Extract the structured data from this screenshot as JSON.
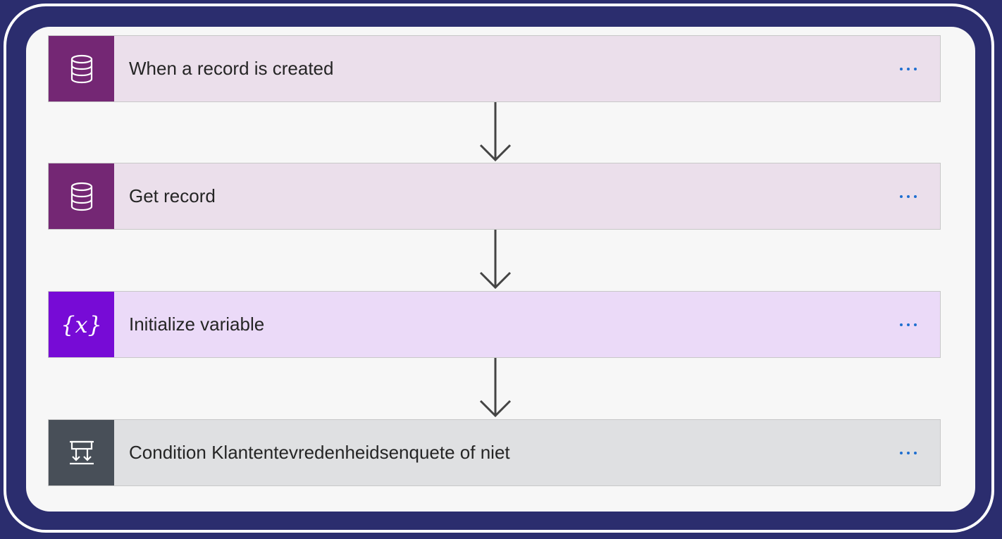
{
  "steps": [
    {
      "label": "When a record is created",
      "icon": "database-icon",
      "icon_bg": "#742774",
      "card_bg": "#ebdfeb"
    },
    {
      "label": "Get record",
      "icon": "database-icon",
      "icon_bg": "#742774",
      "card_bg": "#ebdfeb"
    },
    {
      "label": "Initialize variable",
      "icon": "variable-icon",
      "icon_glyph": "{x}",
      "icon_bg": "#770bd6",
      "card_bg": "#ebdaf8"
    },
    {
      "label": "Condition Klantentevredenheidsenquete of niet",
      "icon": "condition-icon",
      "icon_bg": "#484f58",
      "card_bg": "#dfe0e2"
    }
  ],
  "colors": {
    "outer_bg": "#2b2d6e",
    "canvas_bg": "#f7f7f7",
    "menu_dots": "#1f6fd0",
    "arrow": "#444444"
  }
}
